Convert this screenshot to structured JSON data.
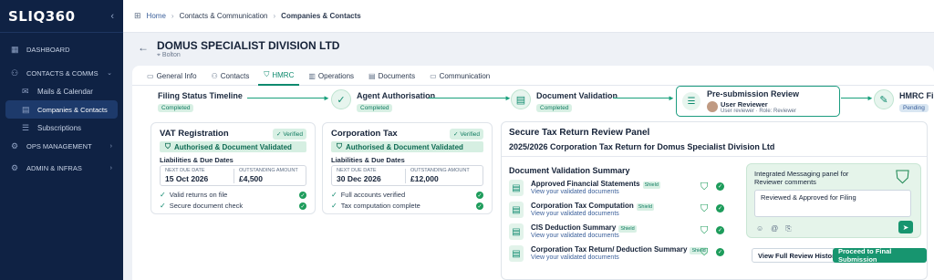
{
  "app": {
    "logo": "SLIQ360",
    "collapse_icon": "chevron-left-icon"
  },
  "sidebar": {
    "dashboard": "DASHBOARD",
    "contacts_comms": "CONTACTS & COMMS",
    "mails": "Mails & Calendar",
    "companies": "Companies & Contacts",
    "subscriptions": "Subscriptions",
    "ops": "OPS MANAGEMENT",
    "admin": "ADMIN & INFRAS"
  },
  "breadcrumb": {
    "home": "Home",
    "sec": "Contacts & Communication",
    "page": "Companies & Contacts"
  },
  "company": {
    "name": "DOMUS SPECIALIST DIVISION LTD",
    "location": "Bolton"
  },
  "tabs": [
    "General Info",
    "Contacts",
    "HMRC",
    "Operations",
    "Documents",
    "Communication"
  ],
  "steps": {
    "s1": {
      "title": "Filing Status Timeline",
      "badge": "Completed"
    },
    "s2": {
      "title": "Agent Authorisation",
      "badge": "Completed"
    },
    "s3": {
      "title": "Document Validation",
      "badge": "Completed"
    },
    "s4": {
      "title": "Pre-submission Review",
      "user": "User Reviewer",
      "role": "User reviewer · Role: Reviewer"
    },
    "s5": {
      "title": "HMRC Fi",
      "badge": "Pending"
    }
  },
  "vat": {
    "title": "VAT Registration",
    "badge": "Verified",
    "auth": "Authorised & Document Validated",
    "ld": "Liabilities & Due Dates",
    "due_label": "NEXT DUE DATE",
    "due": "15 Oct 2026",
    "amt_label": "OUTSTANDING AMOUNT",
    "amt": "£4,500",
    "c1": "Valid returns on file",
    "c2": "Secure document check"
  },
  "ct": {
    "title": "Corporation Tax",
    "badge": "Verified",
    "auth": "Authorised & Document Validated",
    "ld": "Liabilities & Due Dates",
    "due_label": "NEXT DUE DATE",
    "due": "30 Dec 2026",
    "amt_label": "OUTSTANDING AMOUNT",
    "amt": "£12,000",
    "c1": "Full accounts verified",
    "c2": "Tax computation complete"
  },
  "panel": {
    "title": "Secure Tax Return Review Panel",
    "sub": "2025/2026 Corporation Tax Return for Domus Specialist Division Ltd",
    "dvs": "Document Validation Summary",
    "docs": [
      {
        "name": "Approved Financial Statements",
        "shield": "Shield",
        "link": "View your validated documents"
      },
      {
        "name": "Corporation Tax Computation",
        "shield": "Shield",
        "link": "View your validated documents"
      },
      {
        "name": "CIS Deduction Summary",
        "shield": "Shield",
        "link": "View your validated documents"
      },
      {
        "name": "Corporation Tax Return/ Deduction Summary",
        "shield": "Shield",
        "link": "View your validated documents"
      }
    ],
    "msg_title": "Integrated Messaging panel for Reviewer comments",
    "msg_text": "Reviewed & Approved for Filing",
    "btn_history": "View Full Review History",
    "btn_submit": "Proceed to Final Submission"
  },
  "colors": {
    "sidebar": "#0f2244",
    "accent": "#17956f",
    "badge_bg": "#d8f0e4"
  }
}
